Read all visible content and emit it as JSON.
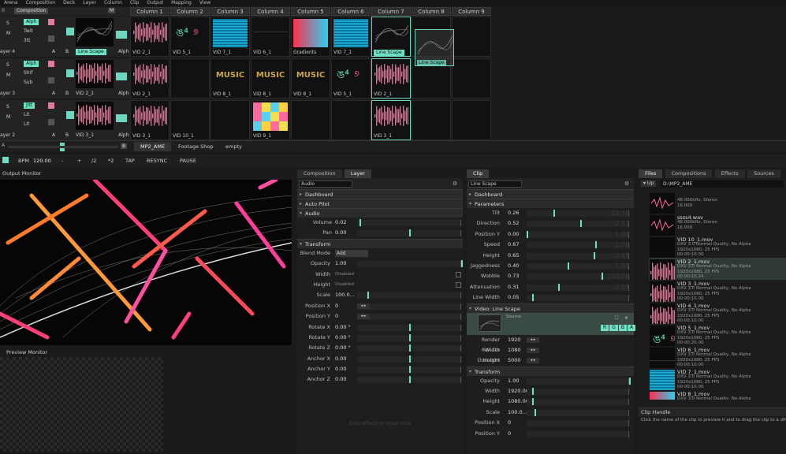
{
  "menu": [
    "Arena",
    "Composition",
    "Deck",
    "Layer",
    "Column",
    "Clip",
    "Output",
    "Mapping",
    "View"
  ],
  "deck": {
    "composition_label": "Composition",
    "columns": [
      "Column 1",
      "Column 2",
      "Column 3",
      "Column 4",
      "Column 5",
      "Column 6",
      "Column 7",
      "Column 8",
      "Column 9"
    ],
    "layers": [
      {
        "name": "ayer 4",
        "blend": [
          "Alph",
          "Twit",
          "3tt"
        ],
        "clips": [
          "VID 2_1",
          "VID 5_1",
          "VID 7_1",
          "VID 6_1",
          "Gradients",
          "VID 7_1",
          "Line Scape",
          "",
          ""
        ],
        "active": "Line Scape"
      },
      {
        "name": "ayer 3",
        "blend": [
          "Alph",
          "Shif",
          "Sub"
        ],
        "clips": [
          "VID 2_1",
          "",
          "VID 8_1",
          "VID 8_1",
          "VID 8_1",
          "VID 5_1",
          "VID 2_1",
          "",
          ""
        ]
      },
      {
        "name": "ayer 2",
        "blend": [
          "Jitt",
          "Lit",
          "Lit"
        ],
        "clips": [
          "VID 3_1",
          "VID 10_1",
          "",
          "VID 9_1",
          "",
          "",
          "VID 3_1",
          "",
          ""
        ]
      }
    ],
    "drag_label": "Line Scape",
    "alph": "Alph",
    "ab_a": "A",
    "ab_b": "B",
    "sm_s": "S",
    "sm_m": "M",
    "decks": [
      "MP2_AME",
      "Footage Shop",
      "empty"
    ],
    "deck_b": "B"
  },
  "transport": {
    "bpm_label": "BPM",
    "bpm": "120.00",
    "minus": "-",
    "plus": "+",
    "half": "/2",
    "double": "*2",
    "tap": "TAP",
    "resync": "RESYNC",
    "pause": "PAUSE"
  },
  "output_monitor": "Output Monitor",
  "preview_monitor": "Preview Monitor",
  "layer_panel": {
    "tabs": [
      "Composition",
      "Layer"
    ],
    "field": "Audio",
    "dashboard": "Dashboard",
    "autopilot": "Auto Pilot",
    "audio": "Audio",
    "transform": "Transform",
    "audio_rows": [
      {
        "l": "Volume",
        "v": "0.02"
      },
      {
        "l": "Pan",
        "v": "0.00"
      }
    ],
    "blend_label": "Blend Mode",
    "blend_value": "Add",
    "rows": [
      {
        "l": "Opacity",
        "v": "1.00"
      },
      {
        "l": "Width",
        "v": "Disabled"
      },
      {
        "l": "Height",
        "v": "Disabled"
      },
      {
        "l": "Scale",
        "v": "100.0..."
      },
      {
        "l": "Position X",
        "v": "0"
      },
      {
        "l": "Position Y",
        "v": "0"
      },
      {
        "l": "Rotate X",
        "v": "0.00 °"
      },
      {
        "l": "Rotate Y",
        "v": "0.00 °"
      },
      {
        "l": "Rotate Z",
        "v": "0.00 °"
      },
      {
        "l": "Anchor X",
        "v": "0.00"
      },
      {
        "l": "Anchor Y",
        "v": "0.00"
      },
      {
        "l": "Anchor Z",
        "v": "0.00"
      }
    ],
    "drop_hint": "Drop effects or mask here"
  },
  "clip_panel": {
    "tab": "Clip",
    "field": "Line Scape",
    "dashboard": "Dashboard",
    "parameters": "Parameters",
    "params": [
      {
        "l": "Tilt",
        "v": "0.26"
      },
      {
        "l": "Direction",
        "v": "0.52"
      },
      {
        "l": "Position Y",
        "v": "0.00"
      },
      {
        "l": "Speed",
        "v": "0.67"
      },
      {
        "l": "Height",
        "v": "0.65"
      },
      {
        "l": "Jaggedness",
        "v": "0.40"
      },
      {
        "l": "Wobble",
        "v": "0.73"
      },
      {
        "l": "Attenuation",
        "v": "0.31"
      },
      {
        "l": "Line Width",
        "v": "0.05"
      }
    ],
    "ghost": [
      "23.50",
      "0.52",
      "1.00",
      "1.00",
      "0.65",
      "1.00",
      "100.00",
      "0.05"
    ],
    "video_section": "Video: Line Scape",
    "source_label": "Source",
    "rgba": [
      "R",
      "G",
      "B",
      "A"
    ],
    "video_rows": [
      {
        "l": "Render Width",
        "v": "1920"
      },
      {
        "l": "Render Height",
        "v": "1080"
      },
      {
        "l": "Duration",
        "v": "5000"
      }
    ],
    "transform": "Transform",
    "trows": [
      {
        "l": "Opacity",
        "v": "1.00"
      },
      {
        "l": "Width",
        "v": "1920.00"
      },
      {
        "l": "Height",
        "v": "1080.00"
      },
      {
        "l": "Scale",
        "v": "100.0..."
      },
      {
        "l": "Position X",
        "v": "0"
      },
      {
        "l": "Position Y",
        "v": "0"
      }
    ]
  },
  "browser": {
    "tabs": [
      "Files",
      "Compositions",
      "Effects",
      "Sources"
    ],
    "up": "Up",
    "path": "D:\\MP2_AME",
    "files": [
      {
        "n": "",
        "d": [
          "48.000kHz, Stereo",
          "16.000"
        ]
      },
      {
        "n": "ssss4.wav",
        "d": [
          "48.000kHz, Stereo",
          "16.000"
        ]
      },
      {
        "n": "VID 10_1.mov",
        "d": [
          "DXV 3.0 Normal Quality, No Alpha",
          "1920x1080, 25 FPS",
          "00:00:10.00"
        ]
      },
      {
        "n": "VID 2_1.mov",
        "d": [
          "DXV 3.0 Normal Quality, No Alpha",
          "1920x1080, 25 FPS",
          "00:00:10.24"
        ]
      },
      {
        "n": "VID 3_1.mov",
        "d": [
          "DXV 3.0 Normal Quality, No Alpha",
          "1920x1080, 25 FPS",
          "00:00:10.00"
        ]
      },
      {
        "n": "VID 4_1.mov",
        "d": [
          "DXV 3.0 Normal Quality, No Alpha",
          "1920x1080, 25 FPS",
          "00:00:10.00"
        ]
      },
      {
        "n": "VID 5_1.mov",
        "d": [
          "DXV 3.0 Normal Quality, No Alpha",
          "1920x1080, 25 FPS",
          "00:00:20.00"
        ]
      },
      {
        "n": "VID 6_1.mov",
        "d": [
          "DXV 3.0 Normal Quality, No Alpha",
          "1920x1080, 25 FPS",
          "00:00:10.00"
        ]
      },
      {
        "n": "VID 7_1.mov",
        "d": [
          "DXV 3.0 Normal Quality, No Alpha",
          "1920x1080, 25 FPS",
          "00:00:10.00"
        ]
      },
      {
        "n": "VID 8_1.mov",
        "d": [
          "DXV 3.0 Normal Quality, No Alpha"
        ]
      }
    ],
    "handle_title": "Clip Handle",
    "handle_text": "Click the name of the clip to preview it and to drag the clip to a diffe"
  }
}
